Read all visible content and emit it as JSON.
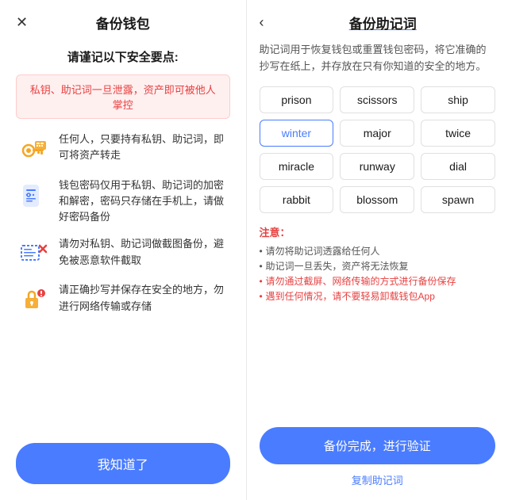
{
  "left": {
    "title": "备份钱包",
    "close_icon": "✕",
    "warning_title": "请谨记以下安全要点:",
    "red_banner": "私钥、助记词一旦泄露，资产即可被他人掌控",
    "tips": [
      {
        "text": "任何人，只要持有私钥、助记词，即可将资产转走"
      },
      {
        "text": "钱包密码仅用于私钥、助记词的加密和解密，密码只存储在手机上，请做好密码备份"
      },
      {
        "text": "请勿对私钥、助记词做截图备份，避免被恶意软件截取"
      },
      {
        "text": "请正确抄写并保存在安全的地方，勿进行网络传输或存储"
      }
    ],
    "know_btn": "我知道了"
  },
  "right": {
    "back_icon": "‹",
    "title": "备份助记词",
    "desc": "助记词用于恢复钱包或重置钱包密码，将它准确的抄写在纸上，并存放在只有你知道的安全的地方。",
    "words": [
      "prison",
      "scissors",
      "ship",
      "winter",
      "major",
      "twice",
      "miracle",
      "runway",
      "dial",
      "rabbit",
      "blossom",
      "spawn"
    ],
    "highlighted_word": "winter",
    "notice_title": "注意：",
    "notices": [
      {
        "text": "请勿将助记词透露给任何人",
        "red": false
      },
      {
        "text": "助记词一旦丢失，资产将无法恢复",
        "red": false
      },
      {
        "text": "请勿通过截屏、网络传输的方式进行备份保存",
        "red": true
      },
      {
        "text": "遇到任何情况，请不要轻易卸载钱包App",
        "red": true
      }
    ],
    "backup_btn": "备份完成，进行验证",
    "copy_btn": "复制助记词"
  }
}
